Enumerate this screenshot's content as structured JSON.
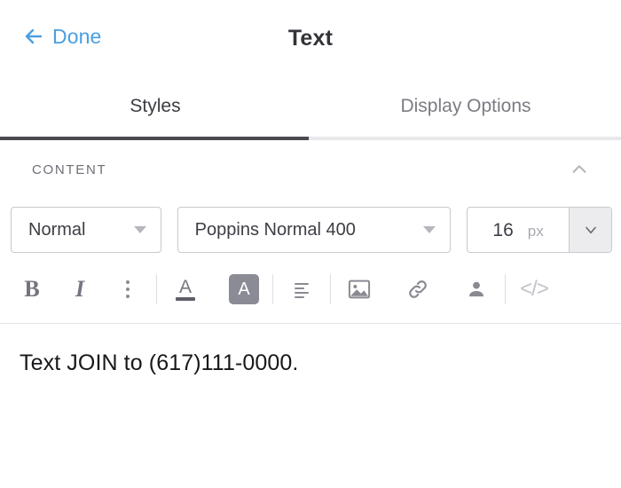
{
  "header": {
    "back_label": "Done",
    "back_icon": "arrow-left-icon",
    "title": "Text",
    "accent_color": "#4a9fe0"
  },
  "tabs": {
    "items": [
      {
        "label": "Styles",
        "active": true
      },
      {
        "label": "Display Options",
        "active": false
      }
    ],
    "active_indicator_color": "#4a4a52"
  },
  "section": {
    "title": "CONTENT",
    "collapse_icon": "chevron-up-icon"
  },
  "controls": {
    "paragraph_style": {
      "value": "Normal",
      "caret_icon": "chevron-down-icon"
    },
    "font_family": {
      "value": "Poppins Normal 400",
      "caret_icon": "chevron-down-icon"
    },
    "font_size": {
      "value": "16",
      "unit": "px",
      "stepper_icon": "chevron-down-icon"
    }
  },
  "toolbar": {
    "buttons": [
      {
        "name": "bold-button",
        "glyph": "B"
      },
      {
        "name": "italic-button",
        "glyph": "I"
      },
      {
        "name": "more-options-button",
        "glyph": ""
      },
      {
        "name": "text-color-button",
        "glyph": "A"
      },
      {
        "name": "highlight-color-button",
        "glyph": "A"
      },
      {
        "name": "align-button",
        "glyph": ""
      },
      {
        "name": "insert-image-button",
        "glyph": ""
      },
      {
        "name": "insert-link-button",
        "glyph": ""
      },
      {
        "name": "merge-field-button",
        "glyph": ""
      },
      {
        "name": "code-view-button",
        "glyph": "</>"
      }
    ]
  },
  "body": {
    "text": "Text JOIN to (617)111-0000."
  }
}
